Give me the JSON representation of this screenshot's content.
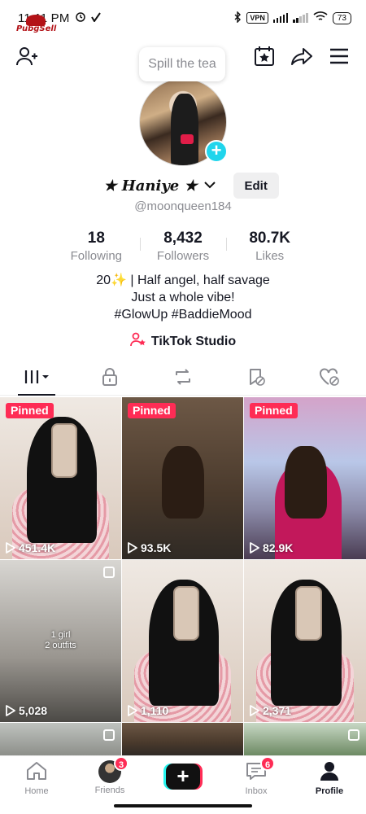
{
  "status_bar": {
    "time": "11:11 PM",
    "vpn": "VPN",
    "battery": "73"
  },
  "watermark": "PubgSell",
  "tea_bubble": "Spill the tea",
  "profile": {
    "display_name": "★ Haniye ★",
    "edit_label": "Edit",
    "handle": "@moonqueen184",
    "stats": [
      {
        "value": "18",
        "label": "Following"
      },
      {
        "value": "8,432",
        "label": "Followers"
      },
      {
        "value": "80.7K",
        "label": "Likes"
      }
    ],
    "bio": [
      "20✨ | Half angel, half savage",
      "Just a whole vibe!",
      "#GlowUp #BaddieMood"
    ],
    "studio_label": "TikTok Studio"
  },
  "videos": [
    {
      "pinned": "Pinned",
      "views": "451.4K"
    },
    {
      "pinned": "Pinned",
      "views": "93.5K"
    },
    {
      "pinned": "Pinned",
      "views": "82.9K"
    },
    {
      "views": "5,028",
      "overlay": [
        "1 girl",
        "2 outfits"
      ]
    },
    {
      "views": "1,110"
    },
    {
      "views": "2,371"
    }
  ],
  "nav": {
    "home": "Home",
    "friends": "Friends",
    "friends_badge": "3",
    "inbox": "Inbox",
    "inbox_badge": "6",
    "profile": "Profile"
  },
  "colors": {
    "accent": "#fe2c55",
    "cyan": "#25f4ee",
    "muted": "#8a8b91"
  }
}
